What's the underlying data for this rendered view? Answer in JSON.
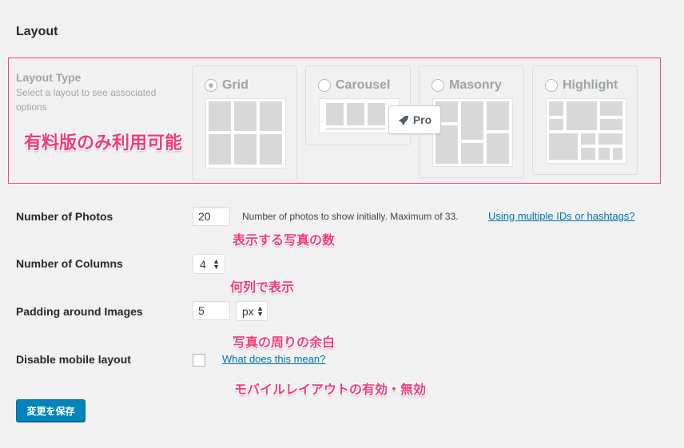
{
  "section": {
    "title": "Layout"
  },
  "layout_type": {
    "title": "Layout Type",
    "description": "Select a layout to see associated options",
    "options": [
      {
        "label": "Grid",
        "selected": true
      },
      {
        "label": "Carousel",
        "selected": false
      },
      {
        "label": "Masonry",
        "selected": false
      },
      {
        "label": "Highlight",
        "selected": false
      }
    ],
    "pro_badge": "Pro"
  },
  "annotations": {
    "paid_only": "有料版のみ利用可能",
    "photos": "表示する写真の数",
    "columns": "何列で表示",
    "padding": "写真の周りの余白",
    "mobile": "モバイルレイアウトの有効・無効"
  },
  "settings": {
    "photos": {
      "label": "Number of Photos",
      "value": "20",
      "help": "Number of photos to show initially. Maximum of 33.",
      "link": "Using multiple IDs or hashtags?"
    },
    "columns": {
      "label": "Number of Columns",
      "value": "4"
    },
    "padding": {
      "label": "Padding around Images",
      "value": "5",
      "unit": "px"
    },
    "mobile": {
      "label": "Disable mobile layout",
      "checked": false,
      "link": "What does this mean?"
    }
  },
  "save_button": "変更を保存",
  "colors": {
    "accent": "#0085ba",
    "annotation": "#ee3c7a",
    "link": "#0073aa"
  }
}
